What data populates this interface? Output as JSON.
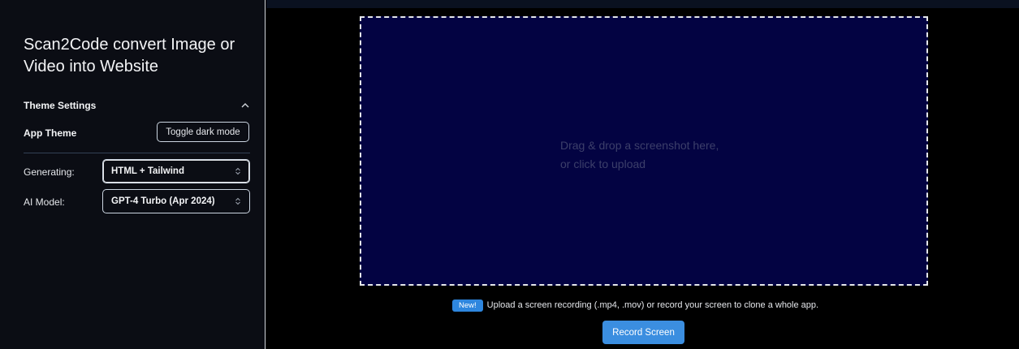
{
  "sidebar": {
    "title": "Scan2Code convert Image or Video into Website",
    "theme_section": {
      "title": "Theme Settings",
      "collapse_icon": "chevron-up-icon",
      "app_theme_label": "App Theme",
      "toggle_label": "Toggle dark mode"
    },
    "generating": {
      "label": "Generating:",
      "value": "HTML + Tailwind"
    },
    "ai_model": {
      "label": "AI Model:",
      "value": "GPT-4 Turbo (Apr 2024)"
    }
  },
  "main": {
    "dropzone": {
      "line1": "Drag & drop a screenshot here,",
      "line2": "or click to upload"
    },
    "new_badge": "New!",
    "recording_text": "Upload a screen recording (.mp4, .mov) or record your screen to clone a whole app.",
    "record_button": "Record Screen"
  },
  "colors": {
    "background": "#000000",
    "sidebar": "#0b0d14",
    "dropzone": "#030342",
    "accent": "#3b8ee0"
  }
}
